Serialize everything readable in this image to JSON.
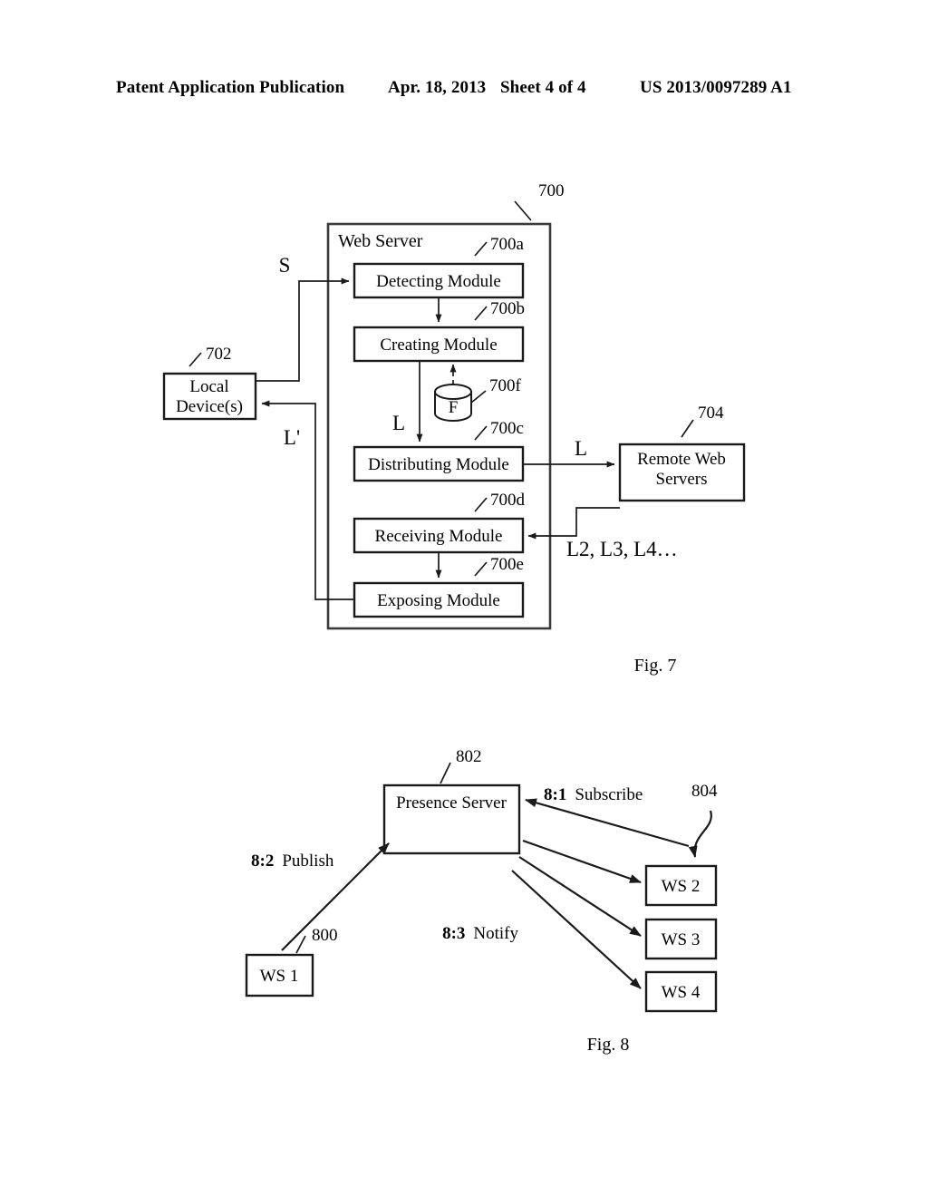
{
  "header": {
    "publication": "Patent Application Publication",
    "date": "Apr. 18, 2013",
    "sheet": "Sheet 4 of 4",
    "number": "US 2013/0097289 A1"
  },
  "figures": [
    {
      "caption": "Fig. 7",
      "container": {
        "ref": "700",
        "title": "Web Server"
      },
      "boxes": [
        {
          "id": "700a",
          "label": "Detecting Module"
        },
        {
          "id": "700b",
          "label": "Creating Module"
        },
        {
          "id": "700c",
          "label": "Distributing Module"
        },
        {
          "id": "700d",
          "label": "Receiving Module"
        },
        {
          "id": "700e",
          "label": "Exposing Module"
        },
        {
          "id": "700f",
          "label": "F"
        },
        {
          "id": "702",
          "label": "Local\nDevice(s)",
          "line1": "Local",
          "line2": "Device(s)"
        },
        {
          "id": "704",
          "label": "Remote Web\nServers",
          "line1": "Remote Web",
          "line2": "Servers"
        }
      ],
      "signals": [
        {
          "name": "S"
        },
        {
          "name": "L'"
        },
        {
          "name": "L"
        },
        {
          "name": "L"
        },
        {
          "name": "L2, L3, L4…"
        }
      ]
    },
    {
      "caption": "Fig. 8",
      "boxes": [
        {
          "id": "800",
          "label": "WS 1"
        },
        {
          "id": "802",
          "label": "Presence Server"
        },
        {
          "id": "804",
          "label": ""
        },
        {
          "id": "ws2",
          "label": "WS 2"
        },
        {
          "id": "ws3",
          "label": "WS 3"
        },
        {
          "id": "ws4",
          "label": "WS 4"
        }
      ],
      "steps": [
        {
          "num": "8:1",
          "name": "Subscribe"
        },
        {
          "num": "8:2",
          "name": "Publish"
        },
        {
          "num": "8:3",
          "name": "Notify"
        }
      ]
    }
  ]
}
